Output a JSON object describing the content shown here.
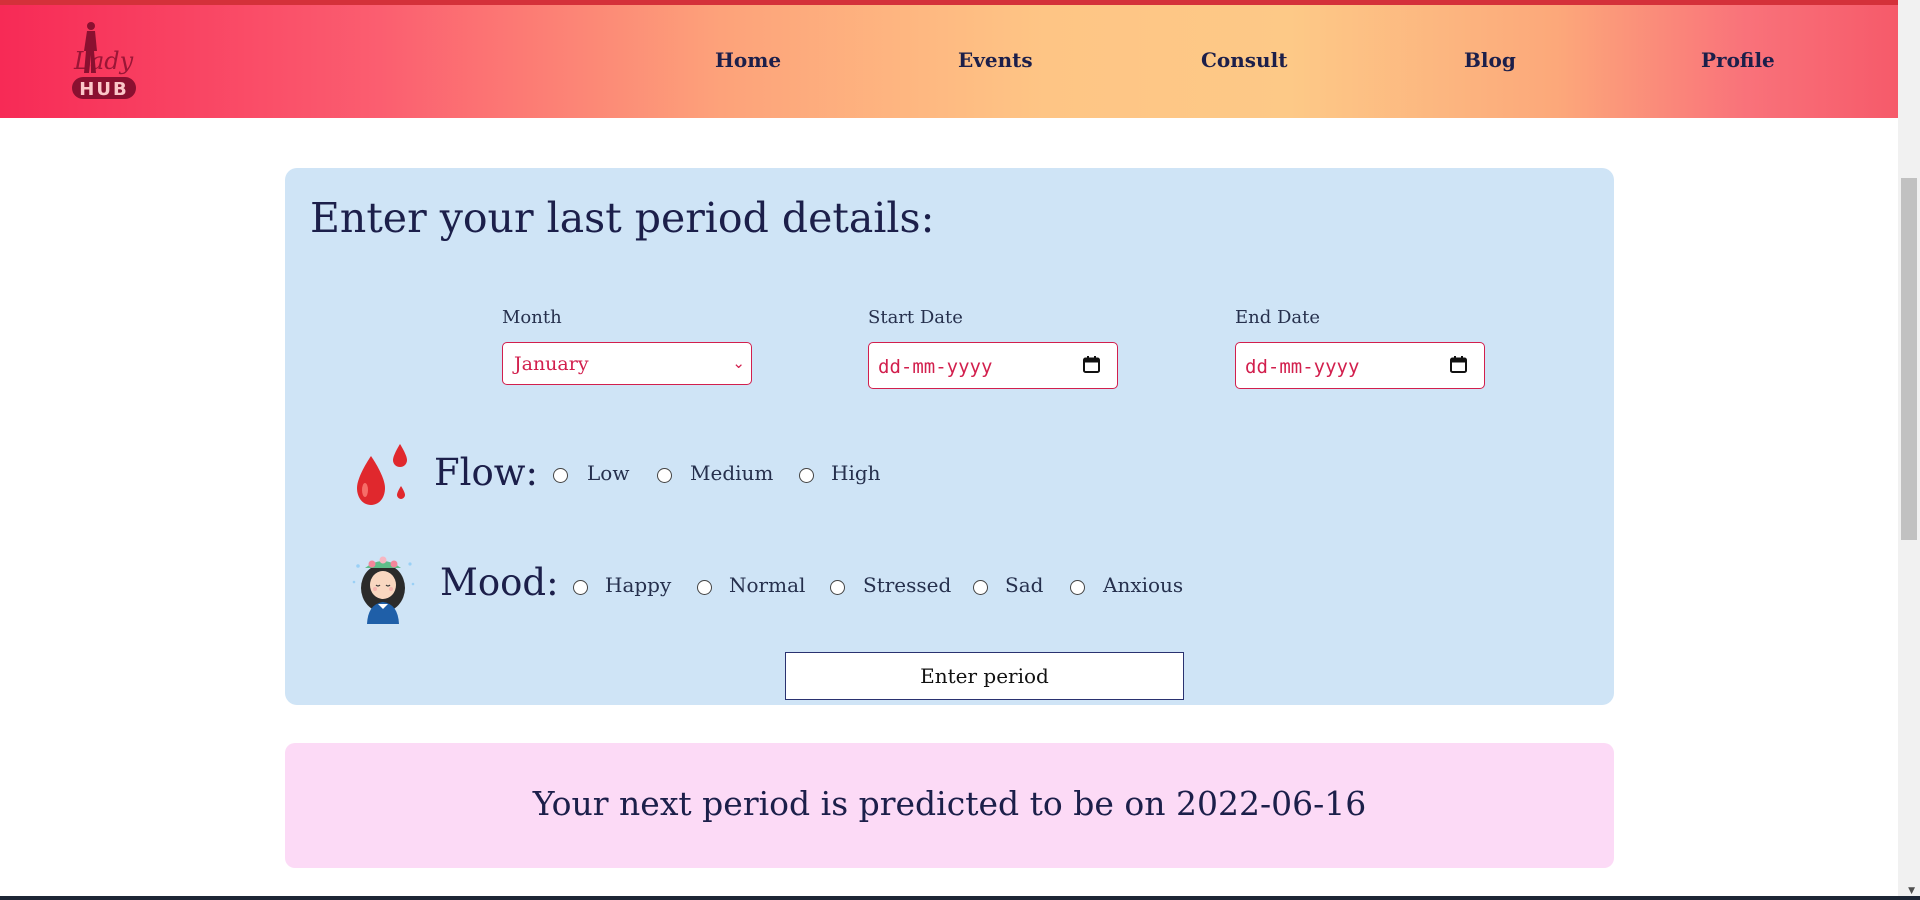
{
  "nav": {
    "logo_text_top": "Lady",
    "logo_text_bottom": "HUB",
    "links": [
      "Home",
      "Events",
      "Consult",
      "Blog",
      "Profile"
    ]
  },
  "form": {
    "title": "Enter your last period details:",
    "month_label": "Month",
    "month_value": "January",
    "start_label": "Start Date",
    "start_placeholder": "dd-mm-yyyy",
    "end_label": "End Date",
    "end_placeholder": "dd-mm-yyyy",
    "flow_label": "Flow:",
    "flow_options": [
      "Low",
      "Medium",
      "High"
    ],
    "mood_label": "Mood:",
    "mood_options": [
      "Happy",
      "Normal",
      "Stressed",
      "Sad",
      "Anxious"
    ],
    "submit_label": "Enter period"
  },
  "result": {
    "text": "Your next period is predicted to be on 2022-06-16"
  },
  "colors": {
    "accent": "#d21f4d",
    "navy": "#1c1f4a",
    "form_bg": "#cfe4f6",
    "result_bg": "#fcdaf6"
  }
}
